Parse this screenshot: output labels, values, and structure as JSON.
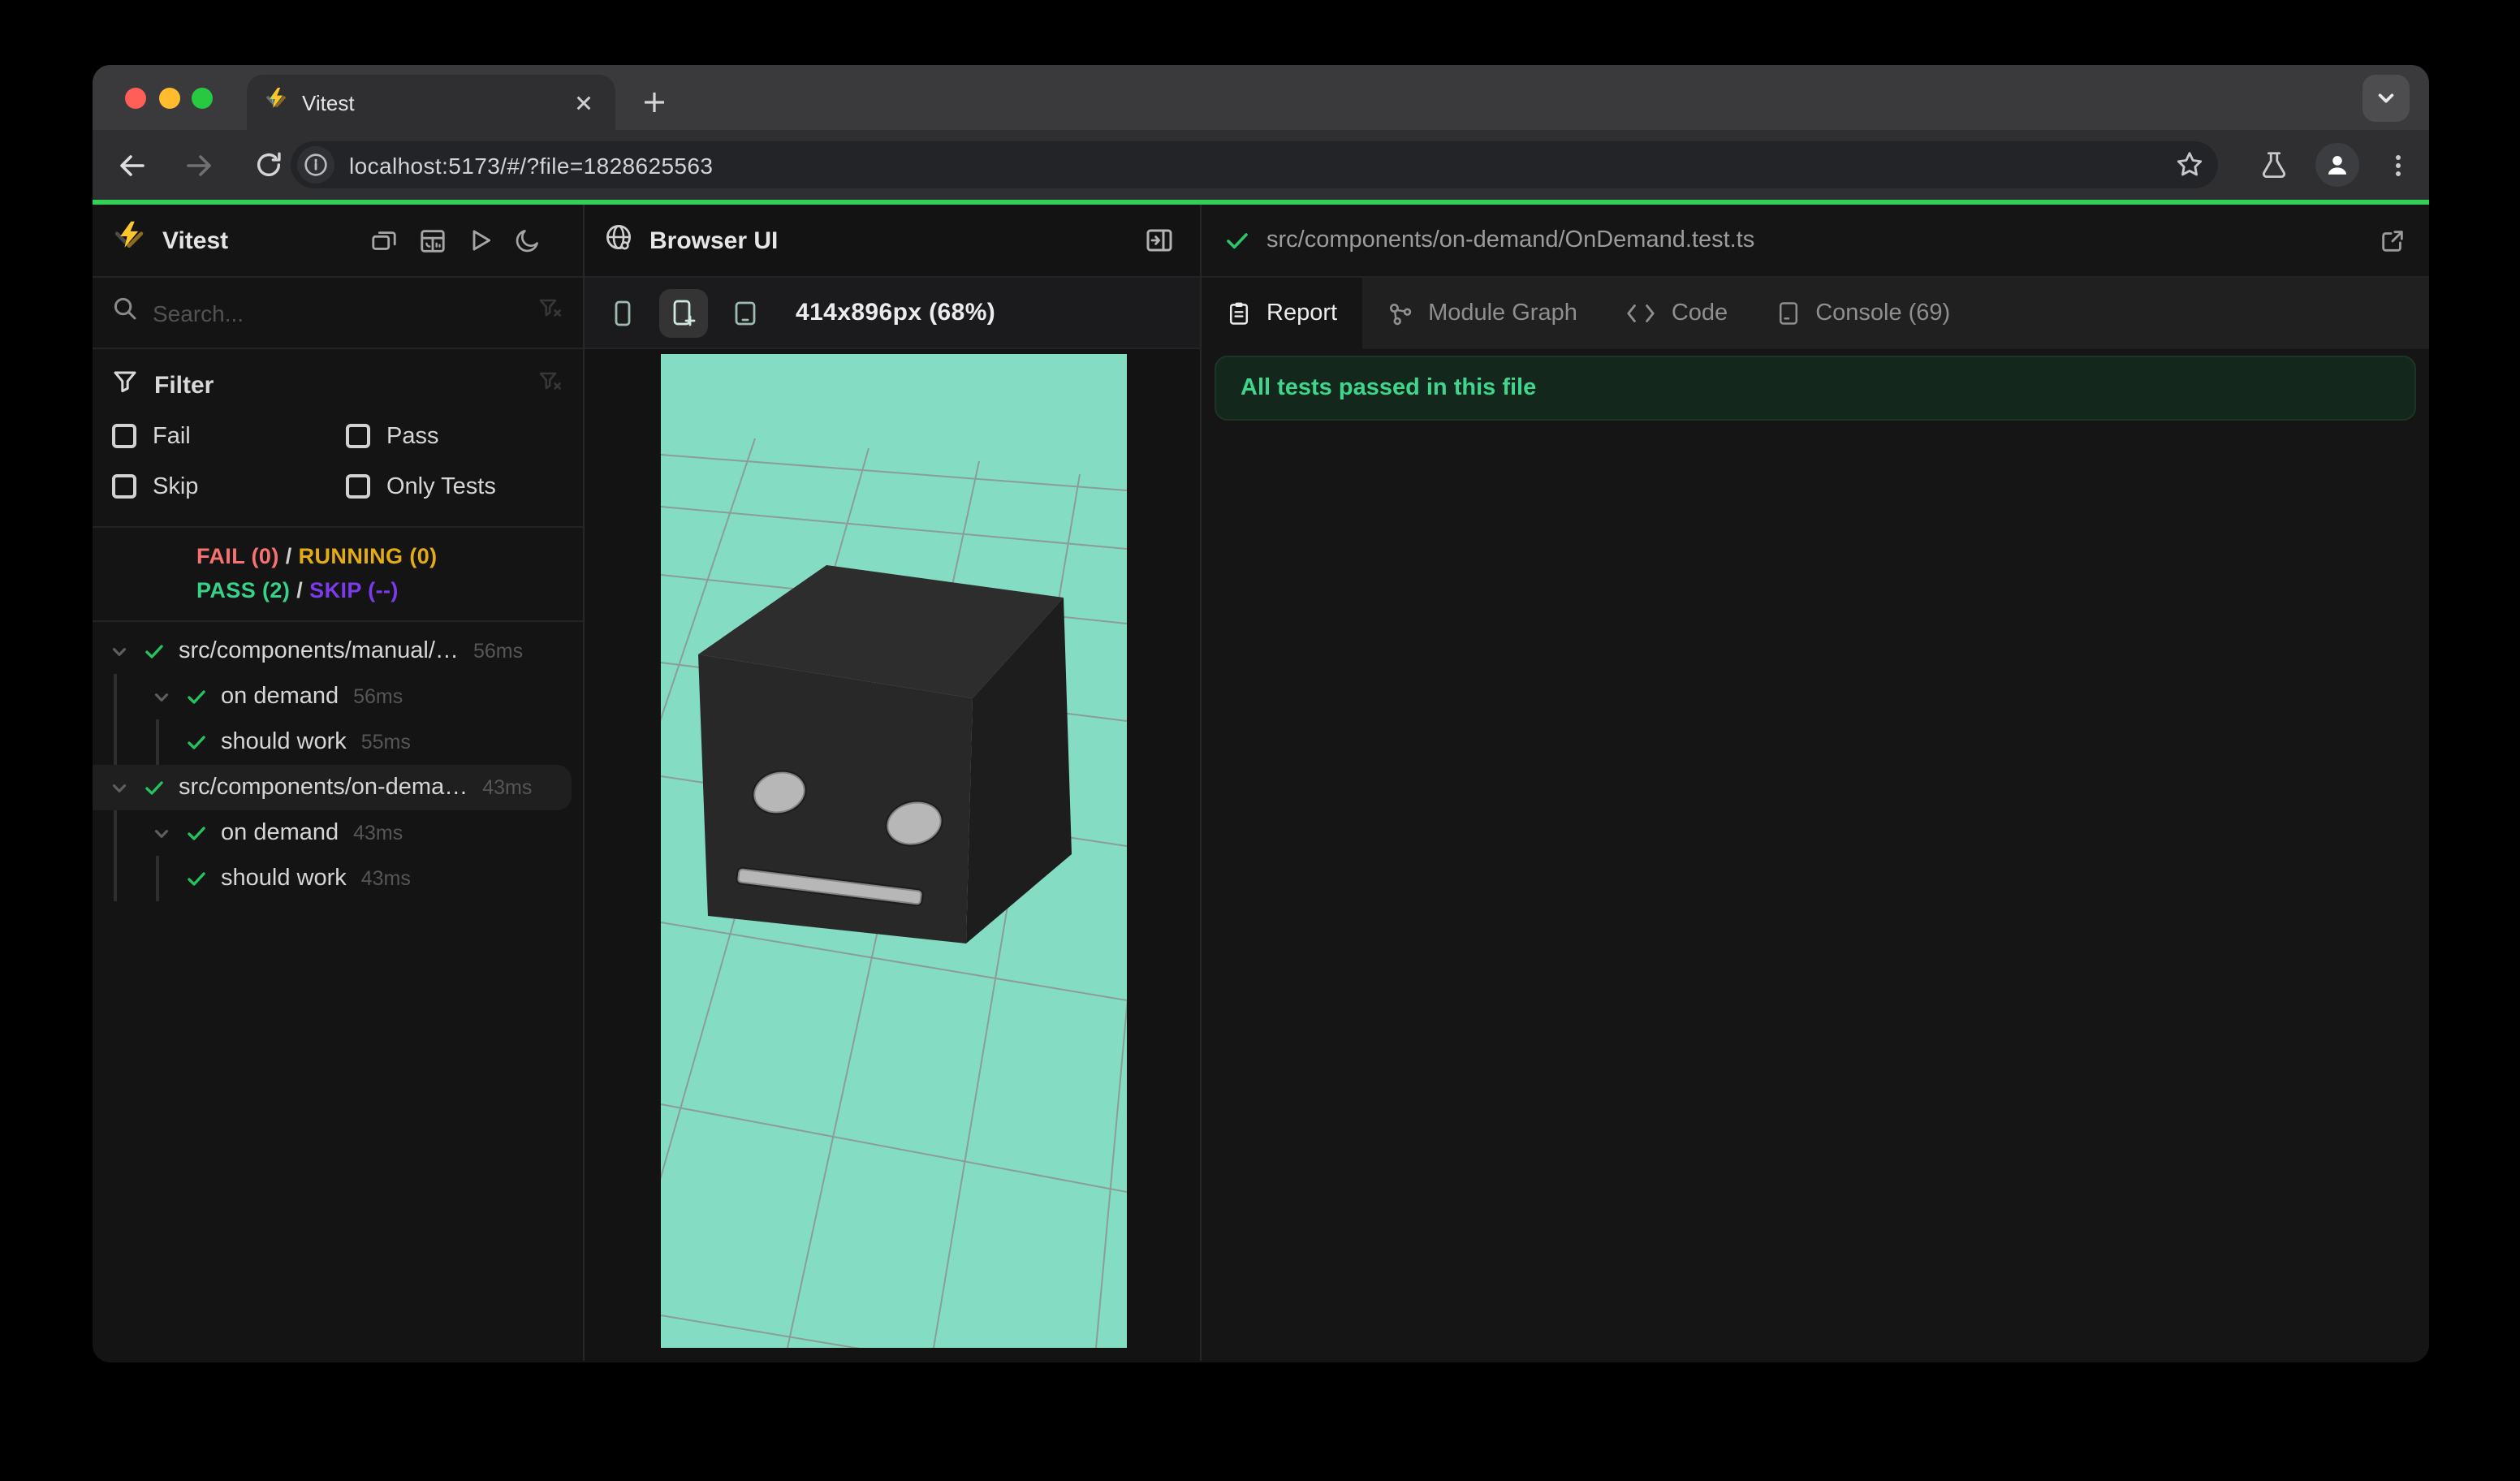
{
  "browser": {
    "tab_title": "Vitest",
    "close_tab_glyph": "×",
    "new_tab_glyph": "+",
    "url": "localhost:5173/#/?file=1828625563"
  },
  "sidebar": {
    "app_title": "Vitest",
    "search_placeholder": "Search...",
    "filter": {
      "title": "Filter",
      "options": [
        {
          "label": "Fail"
        },
        {
          "label": "Pass"
        },
        {
          "label": "Skip"
        },
        {
          "label": "Only Tests"
        }
      ]
    },
    "status": {
      "fail": "FAIL (0)",
      "running": "RUNNING (0)",
      "pass": "PASS (2)",
      "skip": "SKIP (--)",
      "sep": "/"
    },
    "tree": [
      {
        "depth": 0,
        "type": "file",
        "label": "src/components/manual/…",
        "time": "56ms",
        "expanded": true,
        "selected": false
      },
      {
        "depth": 1,
        "type": "suite",
        "label": "on demand",
        "time": "56ms",
        "expanded": true,
        "selected": false
      },
      {
        "depth": 2,
        "type": "test",
        "label": "should work",
        "time": "55ms",
        "expanded": false,
        "selected": false
      },
      {
        "depth": 0,
        "type": "file",
        "label": "src/components/on-dema…",
        "time": "43ms",
        "expanded": true,
        "selected": true
      },
      {
        "depth": 1,
        "type": "suite",
        "label": "on demand",
        "time": "43ms",
        "expanded": true,
        "selected": false
      },
      {
        "depth": 2,
        "type": "test",
        "label": "should work",
        "time": "43ms",
        "expanded": false,
        "selected": false
      }
    ]
  },
  "preview": {
    "title": "Browser UI",
    "viewport_label": "414x896px (68%)",
    "devices": [
      {
        "icon": "phone-icon",
        "active": false
      },
      {
        "icon": "phone-plus-icon",
        "active": true
      },
      {
        "icon": "tablet-icon",
        "active": false
      }
    ]
  },
  "results": {
    "file_path": "src/components/on-demand/OnDemand.test.ts",
    "tabs": [
      {
        "label": "Report",
        "icon": "clipboard-icon",
        "active": true
      },
      {
        "label": "Module Graph",
        "icon": "graph-icon",
        "active": false
      },
      {
        "label": "Code",
        "icon": "code-icon",
        "active": false
      },
      {
        "label": "Console (69)",
        "icon": "console-icon",
        "active": false
      }
    ],
    "banner": "All tests passed in this file"
  },
  "colors": {
    "accent_progress": "#31d158",
    "fail": "#f87171",
    "running": "#e3ac14",
    "pass": "#36d289",
    "skip": "#7c3aed",
    "banner_text": "#3dd68c",
    "mint_background": "#84dcc3",
    "traffic_red": "#ff5f57",
    "traffic_yellow": "#febc2e",
    "traffic_green": "#28c840"
  }
}
